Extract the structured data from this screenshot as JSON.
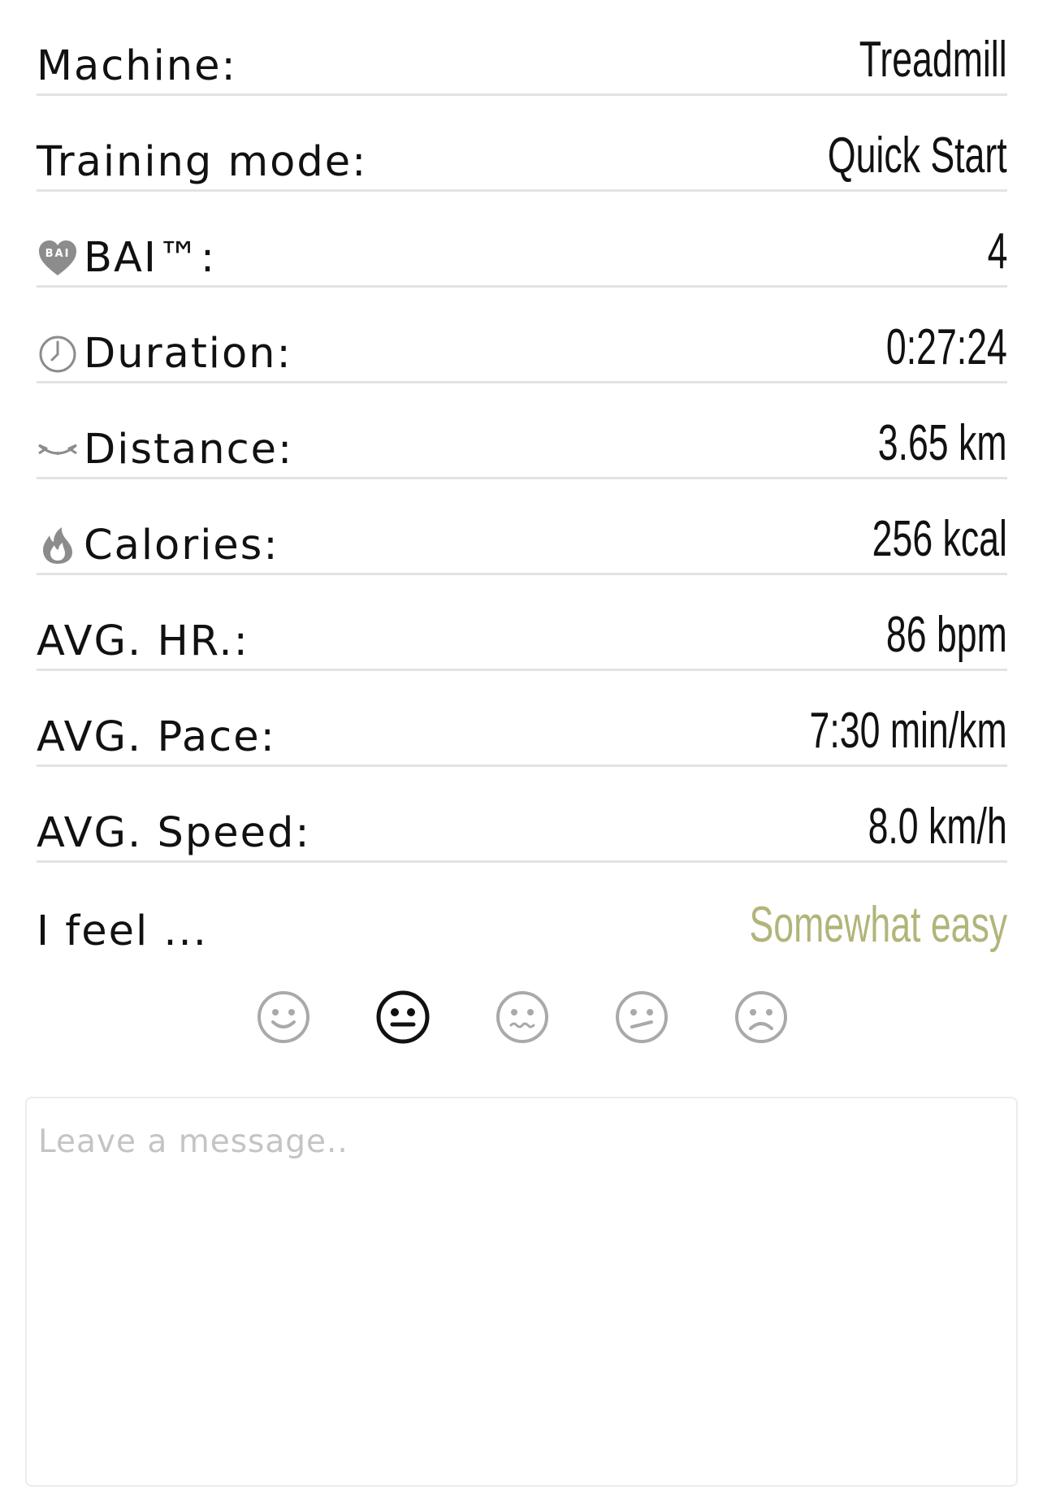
{
  "summary": {
    "rows": [
      {
        "label": "Machine:",
        "value": "Treadmill",
        "icon": ""
      },
      {
        "label": "Training mode:",
        "value": "Quick Start",
        "icon": ""
      },
      {
        "label": "BAI™:",
        "value": "4",
        "icon": "bai-heart-icon",
        "icon_text": "BAI"
      },
      {
        "label": "Duration:",
        "value": "0:27:24",
        "icon": "clock-icon"
      },
      {
        "label": "Distance:",
        "value": "3.65 km",
        "icon": "distance-icon"
      },
      {
        "label": "Calories:",
        "value": "256 kcal",
        "icon": "flame-icon"
      },
      {
        "label": "AVG. HR.:",
        "value": "86 bpm",
        "icon": ""
      },
      {
        "label": "AVG. Pace:",
        "value": "7:30 min/km",
        "icon": ""
      },
      {
        "label": "AVG. Speed:",
        "value": "8.0 km/h",
        "icon": ""
      }
    ]
  },
  "feeling": {
    "label": "I feel ...",
    "value": "Somewhat easy",
    "value_color": "#b3b47a",
    "options": [
      {
        "name": "very-easy",
        "selected": false
      },
      {
        "name": "somewhat-easy",
        "selected": true
      },
      {
        "name": "moderate",
        "selected": false
      },
      {
        "name": "somewhat-hard",
        "selected": false
      },
      {
        "name": "very-hard",
        "selected": false
      }
    ]
  },
  "message": {
    "placeholder": "Leave a message..",
    "value": ""
  },
  "colors": {
    "text": "#111111",
    "divider": "#e3e3e3",
    "icon_gray": "#8c8c8c",
    "face_inactive": "#a9a9a9",
    "face_active": "#111111"
  }
}
